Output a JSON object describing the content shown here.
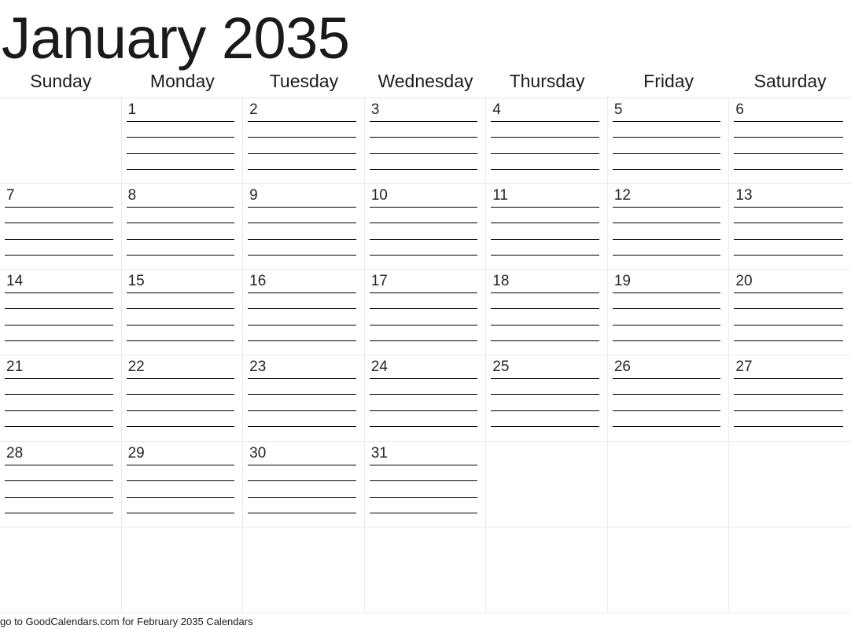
{
  "title": "January 2035",
  "weekdays": [
    "Sunday",
    "Monday",
    "Tuesday",
    "Wednesday",
    "Thursday",
    "Friday",
    "Saturday"
  ],
  "weeks": [
    [
      "",
      "1",
      "2",
      "3",
      "4",
      "5",
      "6"
    ],
    [
      "7",
      "8",
      "9",
      "10",
      "11",
      "12",
      "13"
    ],
    [
      "14",
      "15",
      "16",
      "17",
      "18",
      "19",
      "20"
    ],
    [
      "21",
      "22",
      "23",
      "24",
      "25",
      "26",
      "27"
    ],
    [
      "28",
      "29",
      "30",
      "31",
      "",
      "",
      ""
    ],
    [
      "",
      "",
      "",
      "",
      "",
      "",
      ""
    ]
  ],
  "lines_per_day": 4,
  "footer": "go to GoodCalendars.com for February 2035 Calendars",
  "colors": {
    "text": "#1a1a1a",
    "grid_line": "#ebebeb",
    "rule_line": "#000000",
    "background": "#ffffff"
  }
}
